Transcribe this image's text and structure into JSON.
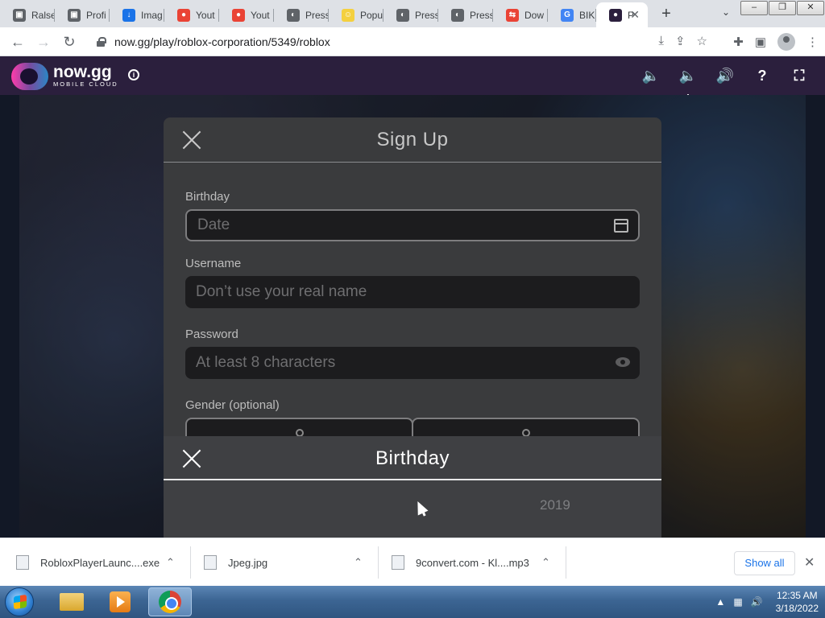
{
  "browser": {
    "tabs": [
      {
        "label": "Ralse",
        "color": "#5f6368",
        "glyph": "▣"
      },
      {
        "label": "Profi",
        "color": "#5f6368",
        "glyph": "▣"
      },
      {
        "label": "Imag",
        "color": "#1a73e8",
        "glyph": "↓"
      },
      {
        "label": "Yout",
        "color": "#ea4335",
        "glyph": "●"
      },
      {
        "label": "Yout",
        "color": "#ea4335",
        "glyph": "●"
      },
      {
        "label": "Press",
        "color": "#5f6368",
        "glyph": "◐"
      },
      {
        "label": "Popu",
        "color": "#f4d03f",
        "glyph": "☺"
      },
      {
        "label": "Press",
        "color": "#5f6368",
        "glyph": "◐"
      },
      {
        "label": "Press",
        "color": "#5f6368",
        "glyph": "◐"
      },
      {
        "label": "Dow",
        "color": "#ea4335",
        "glyph": "⇆"
      },
      {
        "label": "BIKIN",
        "color": "#4285f4",
        "glyph": "G"
      },
      {
        "label": "P",
        "color": "#2b1f3d",
        "glyph": "●",
        "active": true
      }
    ],
    "url": "now.gg/play/roblox-corporation/5349/roblox"
  },
  "nowgg": {
    "logo_main": "now.gg",
    "logo_sub": "MOBILE CLOUD",
    "controls": [
      "volume-down-icon",
      "volume-up-icon",
      "mute-icon",
      "help-icon",
      "fullscreen-icon"
    ]
  },
  "signup": {
    "title": "Sign Up",
    "birthday_label": "Birthday",
    "birthday_placeholder": "Date",
    "username_label": "Username",
    "username_placeholder": "Don’t use your real name",
    "password_label": "Password",
    "password_placeholder": "At least 8 characters",
    "gender_label": "Gender (optional)"
  },
  "birthday_picker": {
    "title": "Birthday",
    "year": "2019"
  },
  "downloads": {
    "items": [
      {
        "name": "RobloxPlayerLaunc....exe"
      },
      {
        "name": "Jpeg.jpg"
      },
      {
        "name": "9convert.com - Kl....mp3"
      }
    ],
    "show_all": "Show all"
  },
  "taskbar": {
    "time": "12:35 AM",
    "date": "3/18/2022"
  }
}
